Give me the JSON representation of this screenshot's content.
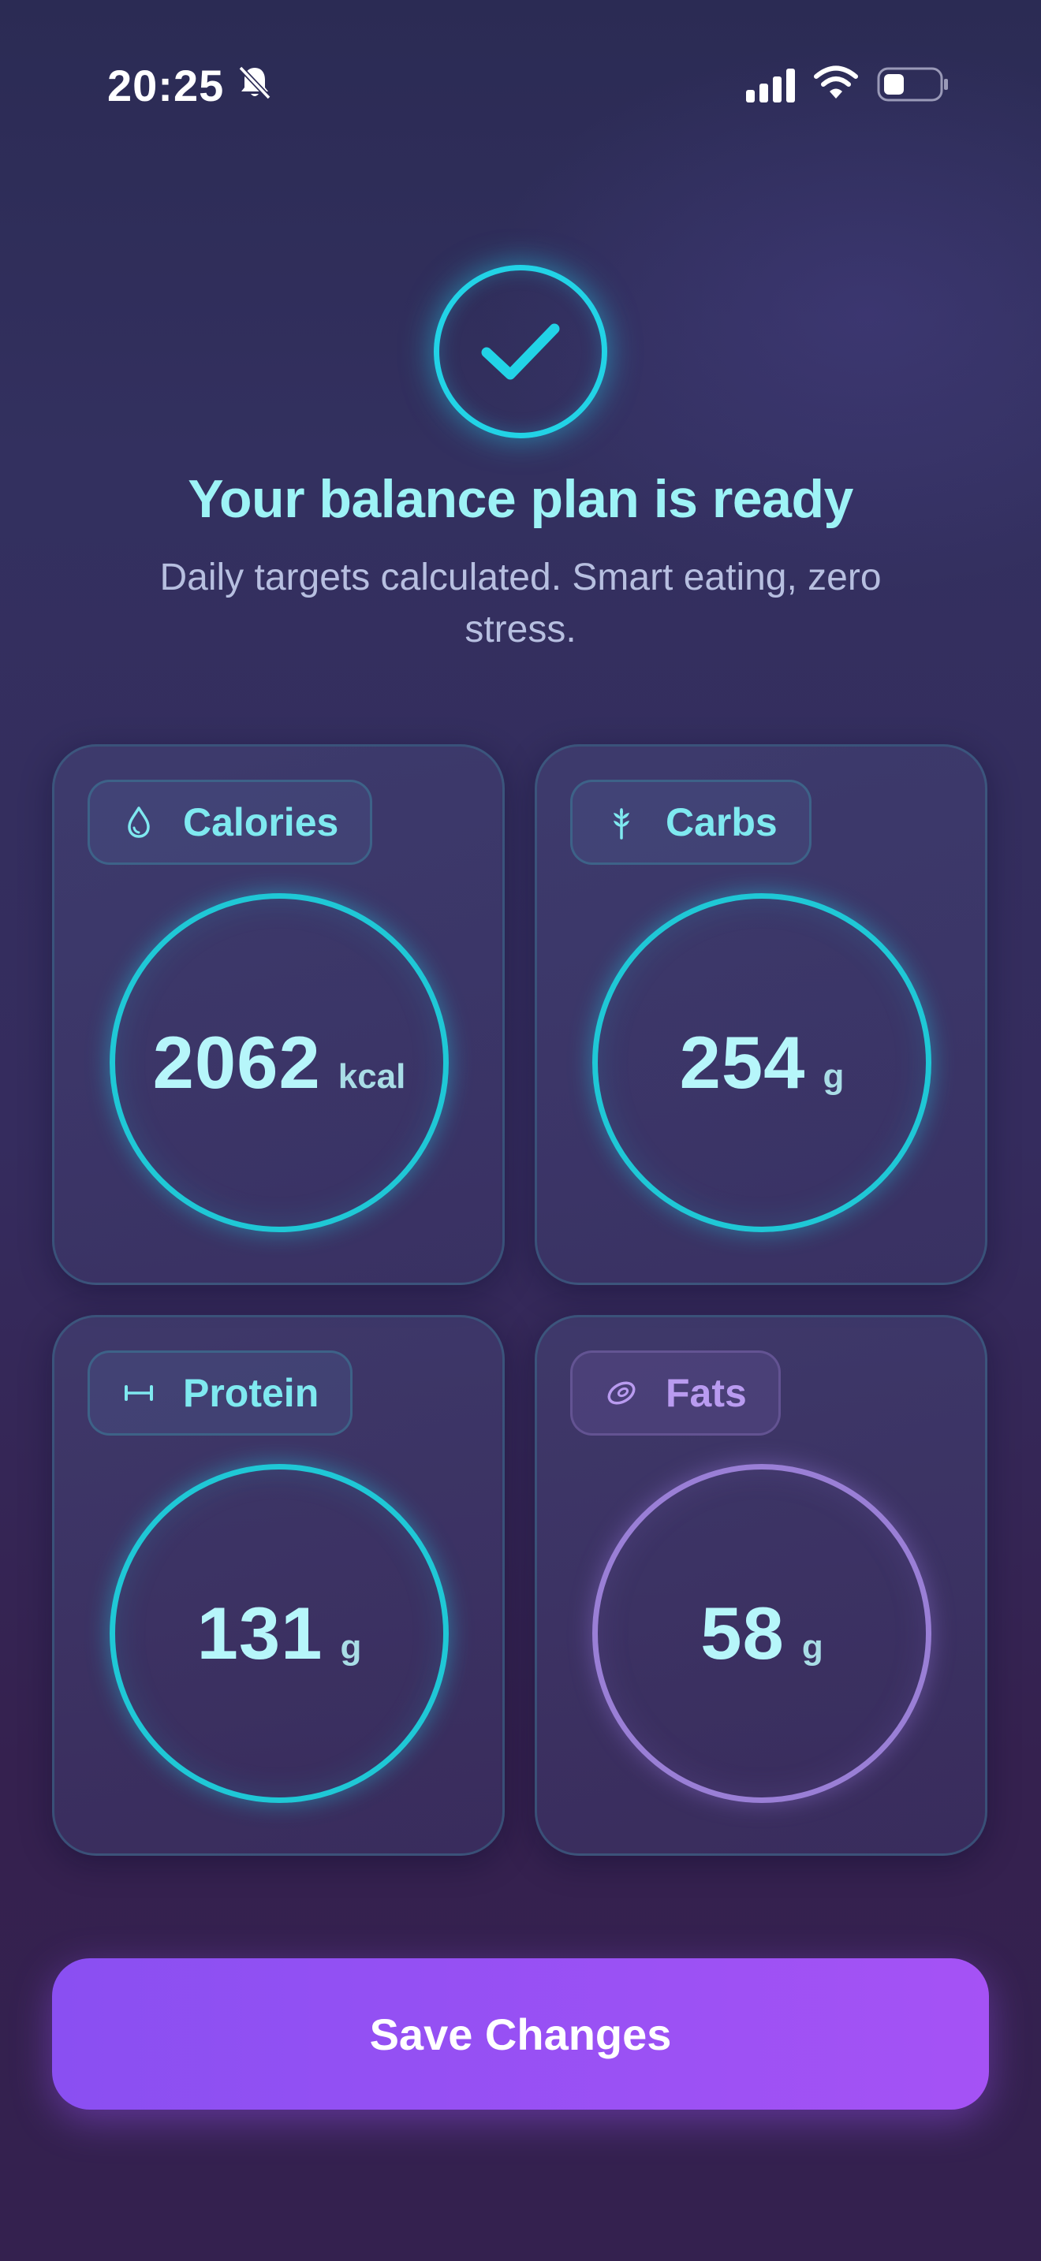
{
  "status_bar": {
    "time": "20:25"
  },
  "header": {
    "title": "Your balance plan is ready",
    "subtitle": "Daily targets calculated. Smart eating, zero stress."
  },
  "macros": {
    "calories": {
      "label": "Calories",
      "value": "2062",
      "unit": "kcal",
      "icon": "drop-icon"
    },
    "carbs": {
      "label": "Carbs",
      "value": "254",
      "unit": "g",
      "icon": "wheat-icon"
    },
    "protein": {
      "label": "Protein",
      "value": "131",
      "unit": "g",
      "icon": "dumbbell-icon"
    },
    "fats": {
      "label": "Fats",
      "value": "58",
      "unit": "g",
      "icon": "avocado-icon"
    }
  },
  "actions": {
    "save_label": "Save Changes"
  },
  "colors": {
    "accent_cyan": "#22d3e6",
    "title_cyan": "#9df3f6",
    "fat_purple": "#9a7fd6",
    "button_purple": "#9a51f4"
  }
}
